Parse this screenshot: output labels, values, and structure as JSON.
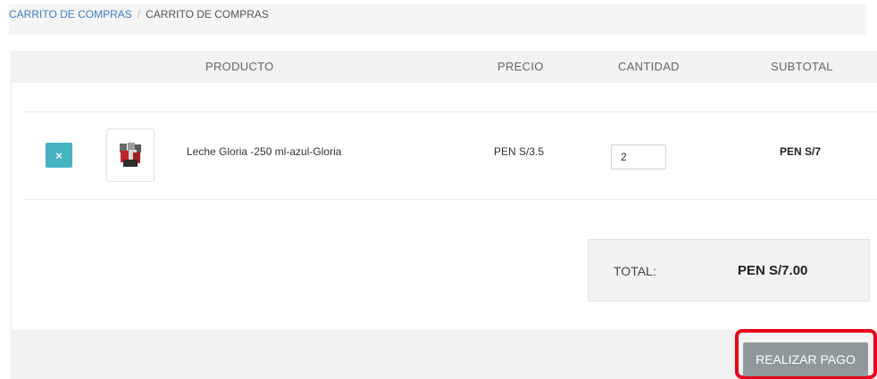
{
  "breadcrumb": {
    "link_label": "CARRITO DE COMPRAS",
    "separator": "/",
    "current_label": "CARRITO DE COMPRAS"
  },
  "table": {
    "headers": {
      "product": "PRODUCTO",
      "price": "PRECIO",
      "quantity": "CANTIDAD",
      "subtotal": "SUBTOTAL"
    },
    "rows": [
      {
        "remove_icon": "close-icon",
        "remove_label": "×",
        "product_name": "Leche Gloria -250 ml-azul-Gloria",
        "price": "PEN S/3.5",
        "quantity": "2",
        "subtotal": "PEN S/7"
      }
    ]
  },
  "totals": {
    "label": "TOTAL:",
    "value": "PEN S/7.00"
  },
  "actions": {
    "pay_label": "REALIZAR PAGO"
  },
  "colors": {
    "remove_button": "#46b3c1",
    "pay_button": "#8f999c",
    "highlight": "#e8001c",
    "link": "#3a7fc1"
  }
}
